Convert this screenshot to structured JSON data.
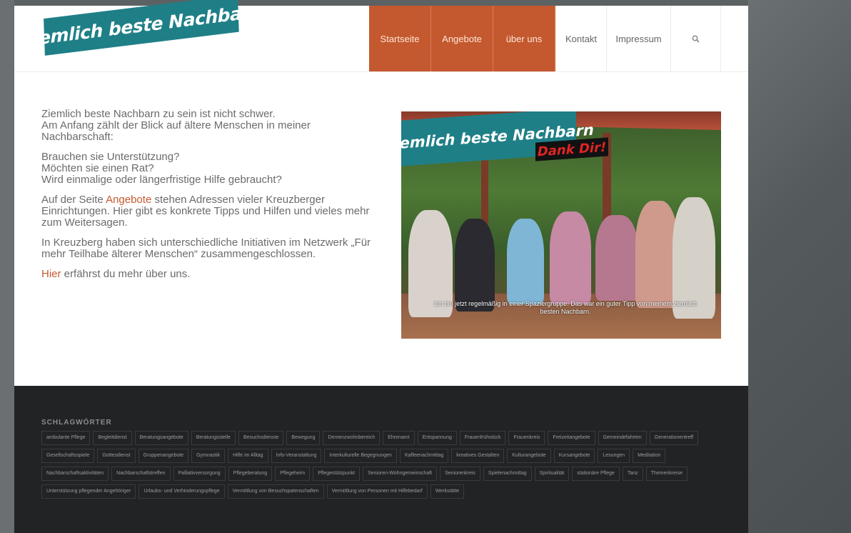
{
  "header": {
    "logo_text": "Ziemlich beste Nachbarn",
    "nav": {
      "startseite": "Startseite",
      "angebote": "Angebote",
      "ueber_uns": "über uns",
      "kontakt": "Kontakt",
      "impressum": "Impressum",
      "search_icon": "search-icon"
    },
    "colors": {
      "accent": "#c4582e",
      "logo_bg": "#1f7f87"
    }
  },
  "main": {
    "p1_line1": "Ziemlich beste Nachbarn zu sein ist nicht schwer.",
    "p1_line2": "Am Anfang zählt der Blick auf ältere Menschen in meiner Nachbarschaft:",
    "p2_line1": "Brauchen sie Unterstützung?",
    "p2_line2": "Möchten sie einen Rat?",
    "p2_line3": "Wird einmalige oder längerfristige Hilfe gebraucht?",
    "p3_before": "Auf der Seite ",
    "p3_link": "Angebote",
    "p3_after": " stehen Adressen vieler Kreuzberger Einrichtungen. Hier gibt es konkrete Tipps und Hilfen und vieles mehr zum Weitersagen.",
    "p4": "In Kreuzberg haben sich unterschiedliche Initiativen im Netzwerk „Für mehr Teilhabe älterer Menschen“ zusammengeschlossen.",
    "p5_link": "Hier",
    "p5_after": " erfährst du mehr über uns."
  },
  "hero": {
    "title": "Ziemlich beste Nachbarn",
    "subtitle": "Dank Dir!",
    "caption": "Ich bin jetzt regelmäßig in einer Spaziergruppe. Das war ein guter Tipp von meinem ziemlich besten Nachbarn."
  },
  "footer": {
    "tags_heading": "SCHLAGWÖRTER",
    "tags": [
      "ambulante Pflege",
      "Begleitdienst",
      "Beratungsangebote",
      "Beratungsstelle",
      "Besuchsdienste",
      "Bewegung",
      "Demenzwohnbereich",
      "Ehrenamt",
      "Entspannung",
      "Frauenfrühstück",
      "Frauenkreis",
      "Freizeitangebote",
      "Gemeindefahrten",
      "Generationentreff",
      "Gesellschaftsspiele",
      "Gottesdienst",
      "Gruppenangebote",
      "Gymnastik",
      "Hilfe im Alltag",
      "Info-Veranstaltung",
      "Interkulturelle Begegnungen",
      "Kaffeenachmittag",
      "kreatives Gestalten",
      "Kulturangebote",
      "Kursangebote",
      "Lesungen",
      "Meditation",
      "Nachbarschaftsaktivitäten",
      "Nachbarschaftstreffen",
      "Palliativversorgung",
      "Pflegeberatung",
      "Pflegeheim",
      "Pflegestützpunkt",
      "Senioren-Wohngemeinschaft",
      "Seniorenkreis",
      "Spielenachmittag",
      "Spiritualität",
      "stationäre Pflege",
      "Tanz",
      "Themenkreise",
      "Unterstützung pflegender Angehöriger",
      "Urlaubs- und Verhinderungspflege",
      "Vermittlung von Besuchspatenschaften",
      "Vermittlung von Personen mit Hilfebedarf",
      "Werkstätte"
    ]
  }
}
